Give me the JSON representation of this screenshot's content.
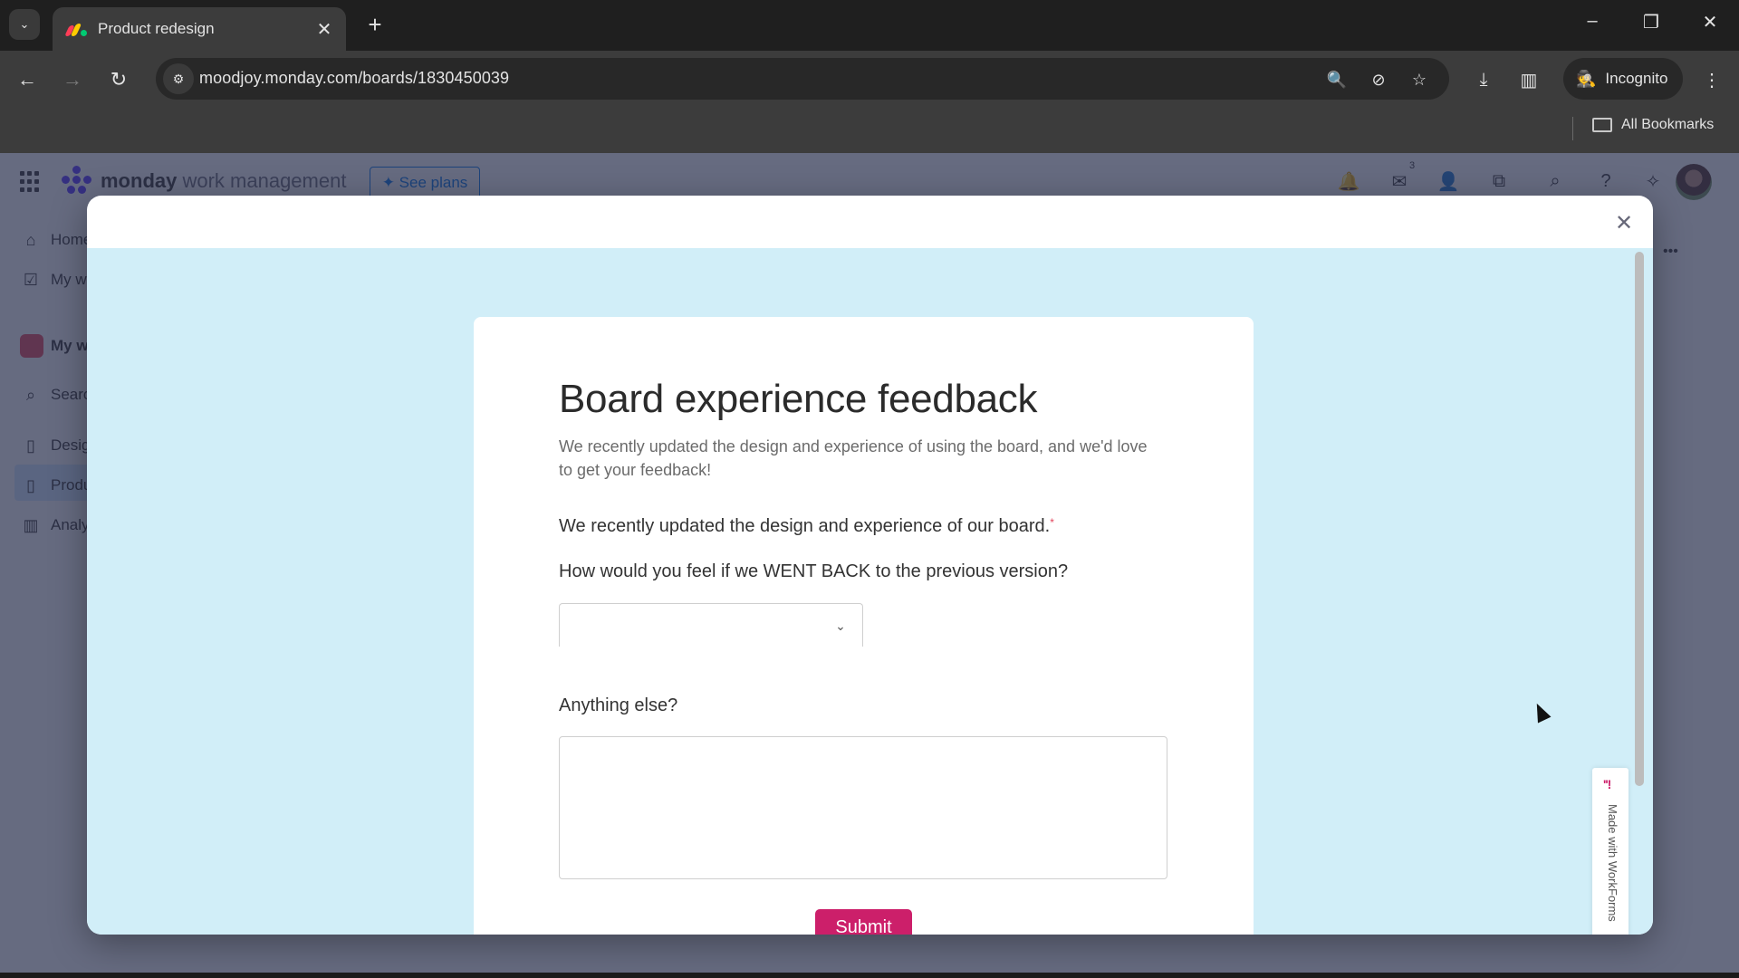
{
  "browser": {
    "tab_title": "Product redesign",
    "new_tab_label": "+",
    "url": "moodjoy.monday.com/boards/1830450039",
    "incognito_label": "Incognito",
    "all_bookmarks_label": "All Bookmarks",
    "window_controls": {
      "minimize": "–",
      "restore": "❐",
      "close": "✕"
    },
    "icons": {
      "tab_list": "⌄",
      "tab_close": "✕",
      "back": "←",
      "forward": "→",
      "reload": "↻",
      "site_info": "⚙",
      "zoom": "🔍",
      "eye_off": "⊘",
      "bookmark_star": "☆",
      "download": "⤓",
      "side_panel": "▥",
      "incognito": "🕵",
      "menu": "⋮"
    }
  },
  "app": {
    "brand_bold": "monday",
    "brand_light": " work management",
    "see_plans_label": "✦ See plans",
    "notifications_badge": "3",
    "header_icons": {
      "bell": "🔔",
      "inbox": "✉",
      "invite": "👤",
      "apps": "⧉",
      "search": "⌕",
      "help": "?",
      "spark": "✧"
    },
    "sidebar": {
      "items": [
        {
          "label": "Home",
          "icon": "⌂"
        },
        {
          "label": "My work",
          "icon": "☑"
        },
        {
          "label": "My workspace",
          "icon": ""
        },
        {
          "label": "Search",
          "icon": "⌕"
        },
        {
          "label": "Design",
          "icon": "▯"
        },
        {
          "label": "Product redesign",
          "icon": "▯"
        },
        {
          "label": "Analytics",
          "icon": "▥"
        }
      ],
      "more_icon": "•••"
    }
  },
  "modal": {
    "close_icon": "✕",
    "form": {
      "title": "Board experience feedback",
      "description": "We recently updated the design and experience of using the board, and we'd love to get your feedback!",
      "question_intro": "We recently updated the design and experience of our board.",
      "required_marker": "*",
      "question_select": "How would you feel if we WENT BACK to the previous version?",
      "select_value": "",
      "select_chevron": "⌄",
      "question_text": "Anything else?",
      "textarea_value": "",
      "submit_label": "Submit"
    },
    "badge": {
      "logo": "''!",
      "text": "Made with WorkForms"
    }
  }
}
